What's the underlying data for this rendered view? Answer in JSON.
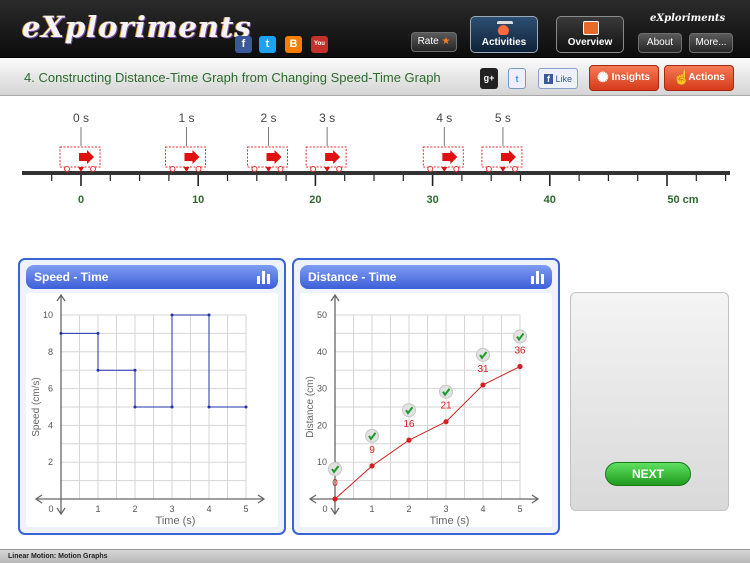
{
  "app": {
    "logo": "eXploriments",
    "small_logo": "eXploriments"
  },
  "topbar": {
    "social": [
      {
        "name": "facebook-icon",
        "glyph": "f",
        "color": "#3b5998"
      },
      {
        "name": "twitter-icon",
        "glyph": "t",
        "color": "#1da1f2"
      },
      {
        "name": "blogger-icon",
        "glyph": "B",
        "color": "#f57d00"
      },
      {
        "name": "youtube-icon",
        "glyph": "You",
        "color": "#c4302b"
      }
    ],
    "rate_label": "Rate",
    "activities_label": "Activities",
    "overview_label": "Overview",
    "about_label": "About",
    "more_label": "More..."
  },
  "titlebar": {
    "title": "4. Constructing Distance-Time Graph from Changing Speed-Time Graph",
    "gplus": "g+",
    "like": "Like",
    "insights_label": "Insights",
    "actions_label": "Actions"
  },
  "ruler": {
    "cart_times": [
      "0 s",
      "1 s",
      "2 s",
      "3 s",
      "4 s",
      "5 s"
    ],
    "cart_positions_cm": [
      0,
      9,
      16,
      21,
      31,
      36
    ],
    "tick_labels": [
      "0",
      "10",
      "20",
      "30",
      "40",
      "50 cm"
    ],
    "max_cm": 50
  },
  "speed_panel": {
    "title": "Speed - Time",
    "chart_data": {
      "type": "line",
      "title": "Speed - Time",
      "xlabel": "Time (s)",
      "ylabel": "Speed (cm/s)",
      "xlim": [
        0,
        5
      ],
      "ylim": [
        0,
        10
      ],
      "x_ticks": [
        "0",
        "1",
        "2",
        "3",
        "4",
        "5"
      ],
      "y_ticks": [
        "2",
        "4",
        "6",
        "8",
        "10"
      ],
      "x": [
        0,
        1,
        1,
        2,
        2,
        3,
        3,
        4,
        4,
        5
      ],
      "y": [
        9,
        9,
        7,
        7,
        5,
        5,
        10,
        10,
        5,
        5
      ],
      "color": "#2233aa"
    }
  },
  "distance_panel": {
    "title": "Distance - Time",
    "chart_data": {
      "type": "line",
      "title": "Distance - Time",
      "xlabel": "Time (s)",
      "ylabel": "Distance (cm)",
      "xlim": [
        0,
        5
      ],
      "ylim": [
        0,
        50
      ],
      "x_ticks": [
        "0",
        "1",
        "2",
        "3",
        "4",
        "5"
      ],
      "y_ticks": [
        "10",
        "20",
        "30",
        "40",
        "50"
      ],
      "x": [
        0,
        1,
        2,
        3,
        4,
        5
      ],
      "y": [
        0,
        9,
        16,
        21,
        31,
        36
      ],
      "point_labels": [
        "0",
        "9",
        "16",
        "21",
        "31",
        "36"
      ],
      "color": "#d42020"
    }
  },
  "next_label": "NEXT",
  "footer": "Linear Motion: Motion Graphs"
}
